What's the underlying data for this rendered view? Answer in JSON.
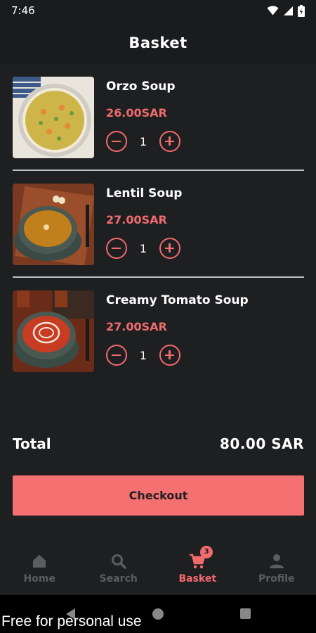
{
  "status_bar": {
    "time": "7:46"
  },
  "header": {
    "title": "Basket"
  },
  "basket": {
    "items": [
      {
        "name": "Orzo Soup",
        "price": "26.00SAR",
        "quantity": "1"
      },
      {
        "name": "Lentil Soup",
        "price": "27.00SAR",
        "quantity": "1"
      },
      {
        "name": "Creamy Tomato Soup",
        "price": "27.00SAR",
        "quantity": "1"
      }
    ],
    "total_label": "Total",
    "total_value": "80.00 SAR",
    "checkout_label": "Checkout"
  },
  "bottom_nav": {
    "items": [
      {
        "label": "Home",
        "icon": "home-icon"
      },
      {
        "label": "Search",
        "icon": "search-icon"
      },
      {
        "label": "Basket",
        "icon": "cart-icon",
        "badge": "3",
        "active": true
      },
      {
        "label": "Profile",
        "icon": "person-icon"
      }
    ]
  },
  "watermark": "Free for personal use",
  "colors": {
    "accent": "#f06b6e",
    "background": "#1e1f21",
    "button": "#f57070"
  }
}
